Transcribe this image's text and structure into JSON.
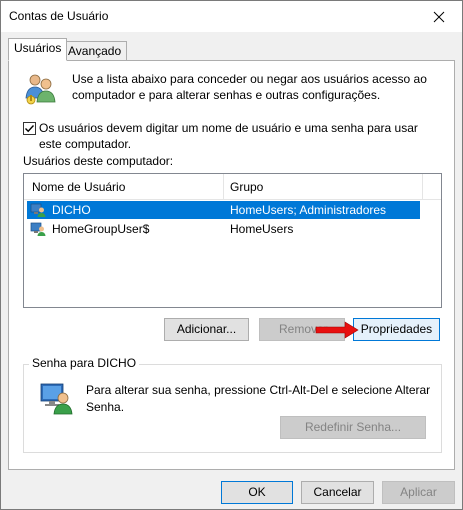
{
  "window": {
    "title": "Contas de Usuário"
  },
  "tabs": [
    {
      "label": "Usuários"
    },
    {
      "label": "Avançado"
    }
  ],
  "intro": {
    "text": "Use a lista abaixo para conceder ou negar aos usuários acesso ao computador e para alterar senhas e outras configurações."
  },
  "require_login": {
    "label": "Os usuários devem digitar um nome de usuário e uma senha para usar este computador.",
    "checked": true
  },
  "users_list": {
    "caption": "Usuários deste computador:",
    "columns": [
      "Nome de Usuário",
      "Grupo"
    ],
    "rows": [
      {
        "name": "DICHO",
        "group": "HomeUsers; Administradores",
        "selected": true,
        "icon": "user-account-icon"
      },
      {
        "name": "HomeGroupUser$",
        "group": "HomeUsers",
        "selected": false,
        "icon": "user-account-icon"
      }
    ]
  },
  "list_buttons": {
    "add": "Adicionar...",
    "remove": "Remover",
    "properties": "Propriedades"
  },
  "password_group": {
    "label": "Senha para DICHO",
    "text": "Para alterar sua senha, pressione Ctrl-Alt-Del e selecione Alterar Senha.",
    "reset_button": "Redefinir Senha..."
  },
  "footer": {
    "ok": "OK",
    "cancel": "Cancelar",
    "apply": "Aplicar"
  },
  "colors": {
    "selection": "#0078d7",
    "arrow": "#e81010"
  }
}
